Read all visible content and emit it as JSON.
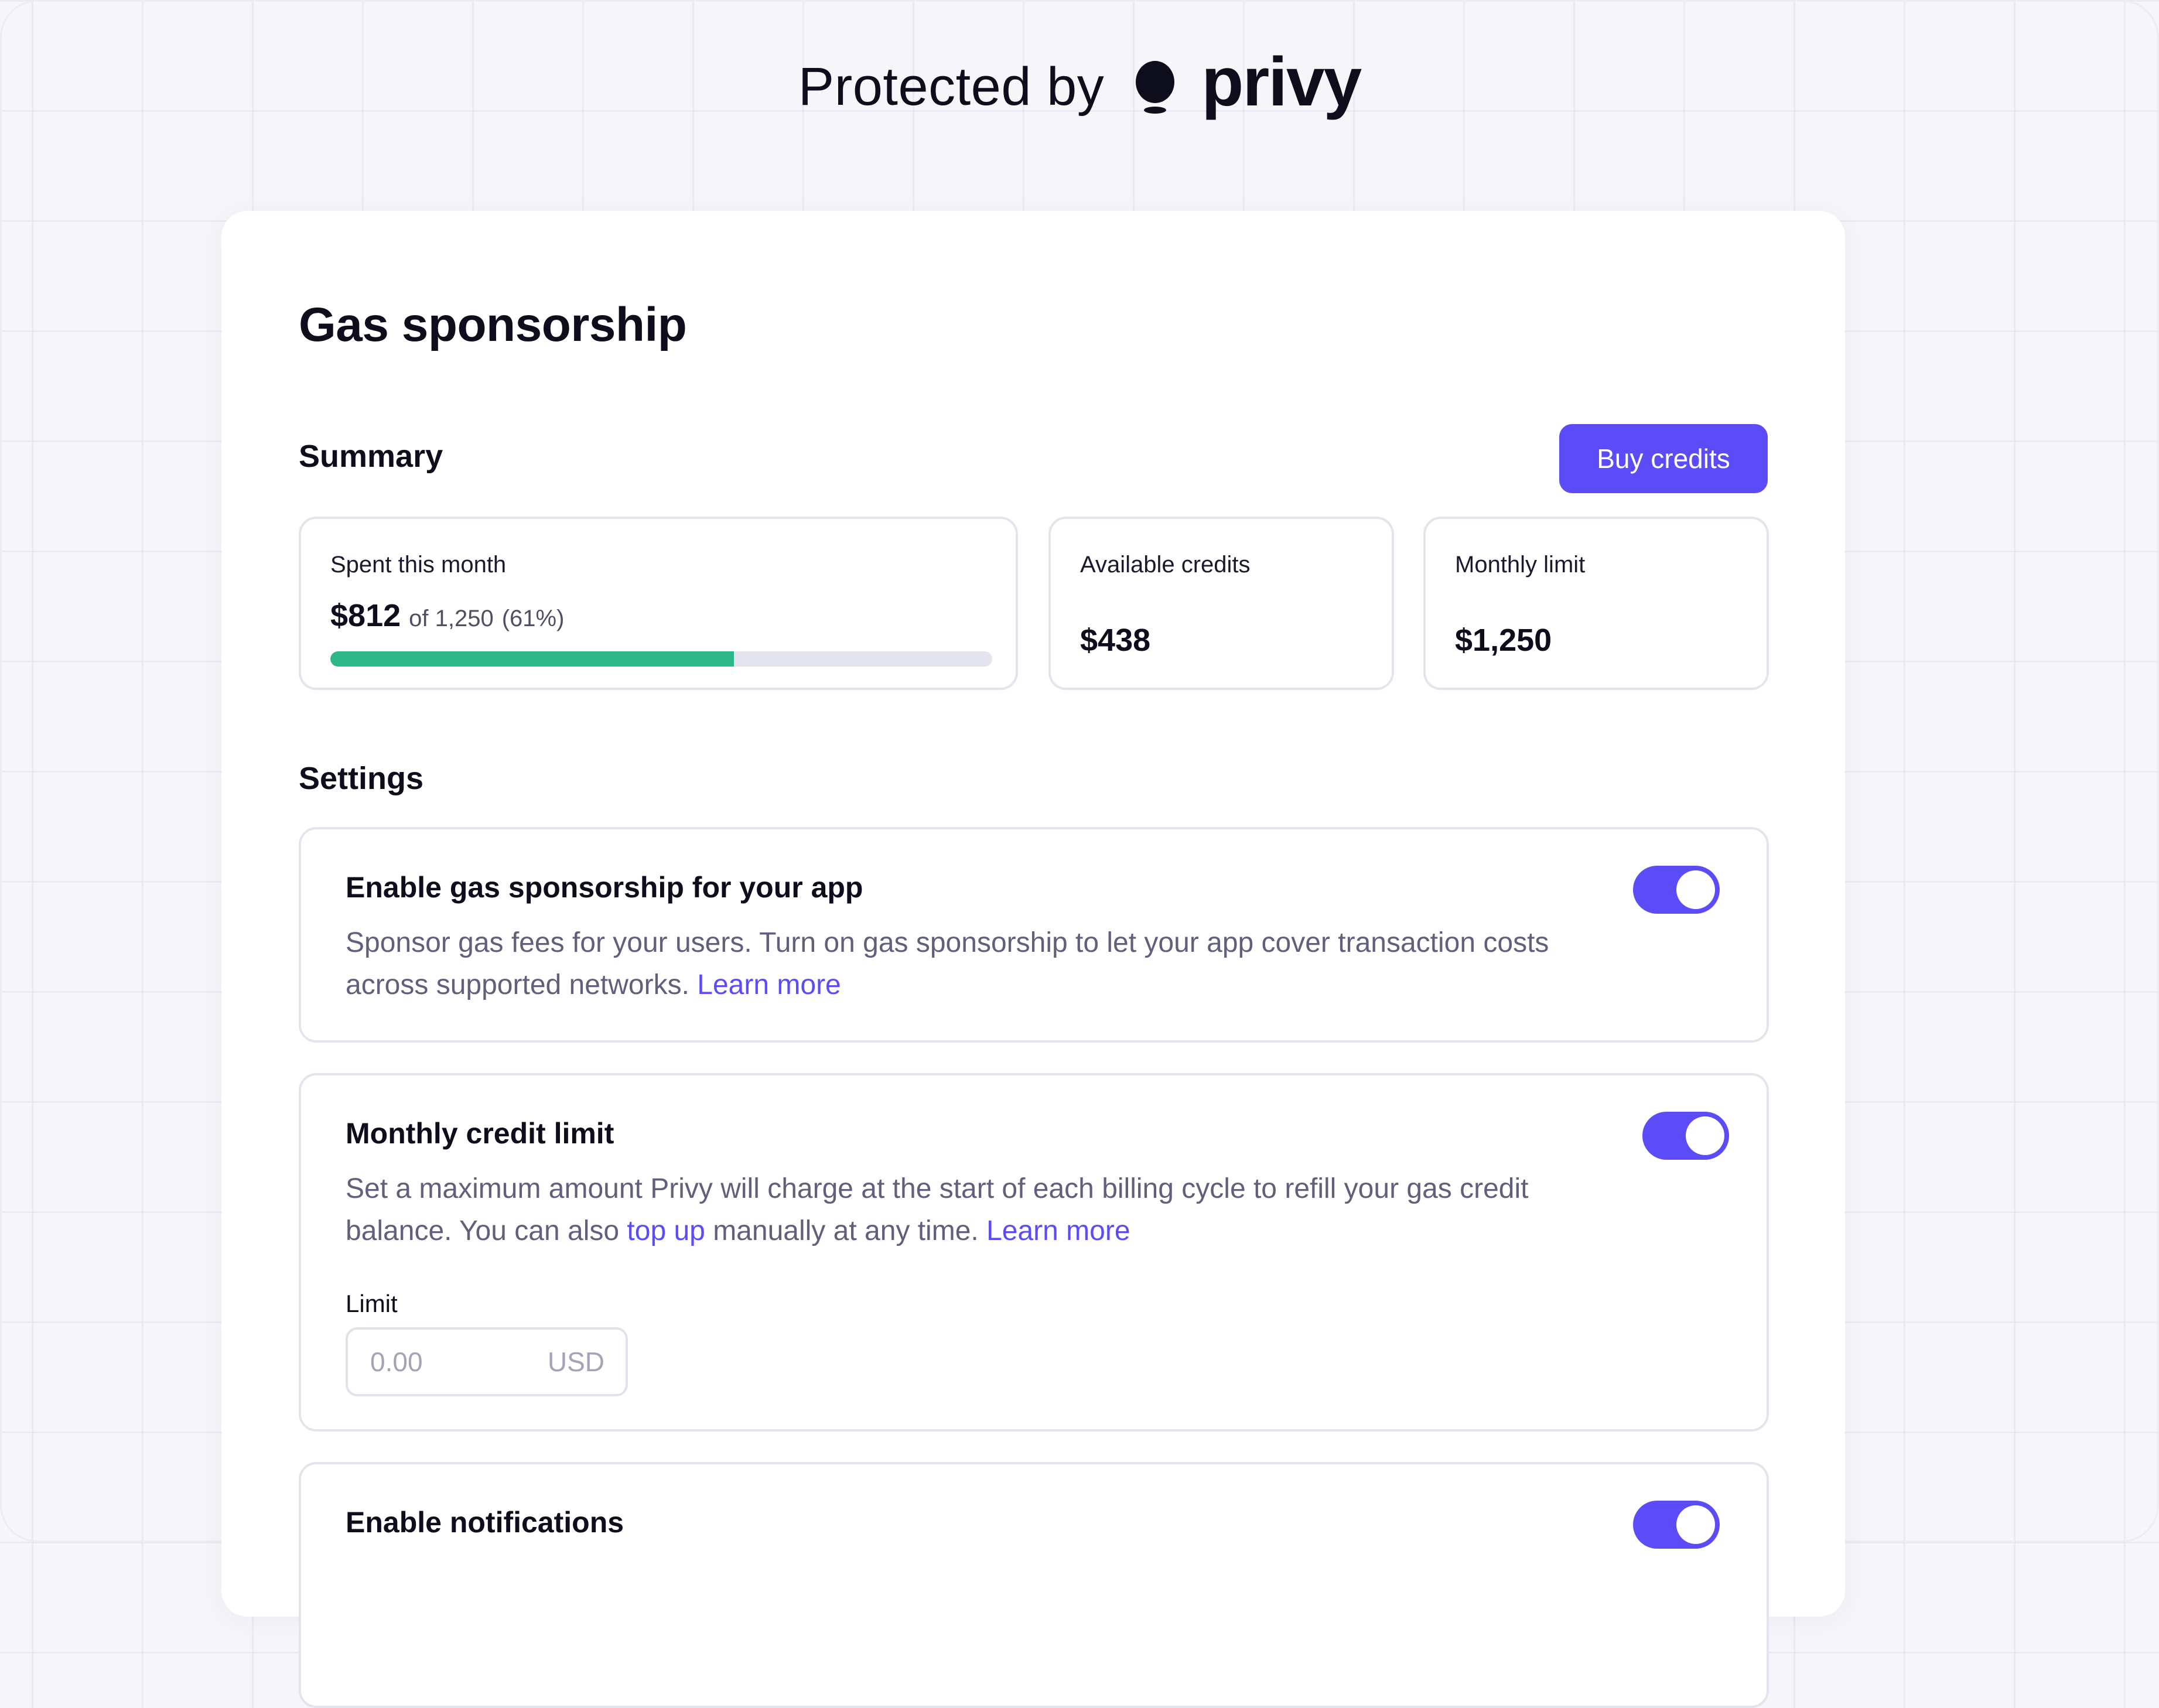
{
  "header": {
    "protected_by": "Protected by",
    "brand_name": "privy",
    "brand_icon": "privy-logo-icon"
  },
  "page": {
    "title": "Gas sponsorship"
  },
  "summary": {
    "title": "Summary",
    "buy_button": "Buy credits",
    "spent": {
      "label": "Spent this month",
      "amount": "$812",
      "of_text": "of 1,250",
      "percent_text": "(61%)",
      "progress_fraction": 0.61
    },
    "available": {
      "label": "Available credits",
      "value": "$438"
    },
    "limit": {
      "label": "Monthly limit",
      "value": "$1,250"
    }
  },
  "settings": {
    "title": "Settings",
    "gas": {
      "title": "Enable gas sponsorship for your app",
      "desc": "Sponsor gas fees for your users. Turn on gas sponsorship to let your app cover transaction costs across supported networks. ",
      "learn_more": "Learn more",
      "enabled": true
    },
    "credit_limit": {
      "title": "Monthly credit limit",
      "desc_part1": "Set a maximum amount Privy will charge at the start of each billing cycle to refill your gas credit balance. You can also ",
      "top_up": "top up",
      "desc_part2": " manually at any time. ",
      "learn_more": "Learn more",
      "enabled": true,
      "field_label": "Limit",
      "placeholder": "0.00",
      "value": "",
      "unit": "USD"
    },
    "notifications": {
      "title": "Enable notifications",
      "enabled": true
    }
  },
  "colors": {
    "accent": "#5b4cf7",
    "progress": "#2eb88a",
    "progress_track": "#e4e4ee",
    "text": "#0d0d1c",
    "muted": "#60607a"
  }
}
